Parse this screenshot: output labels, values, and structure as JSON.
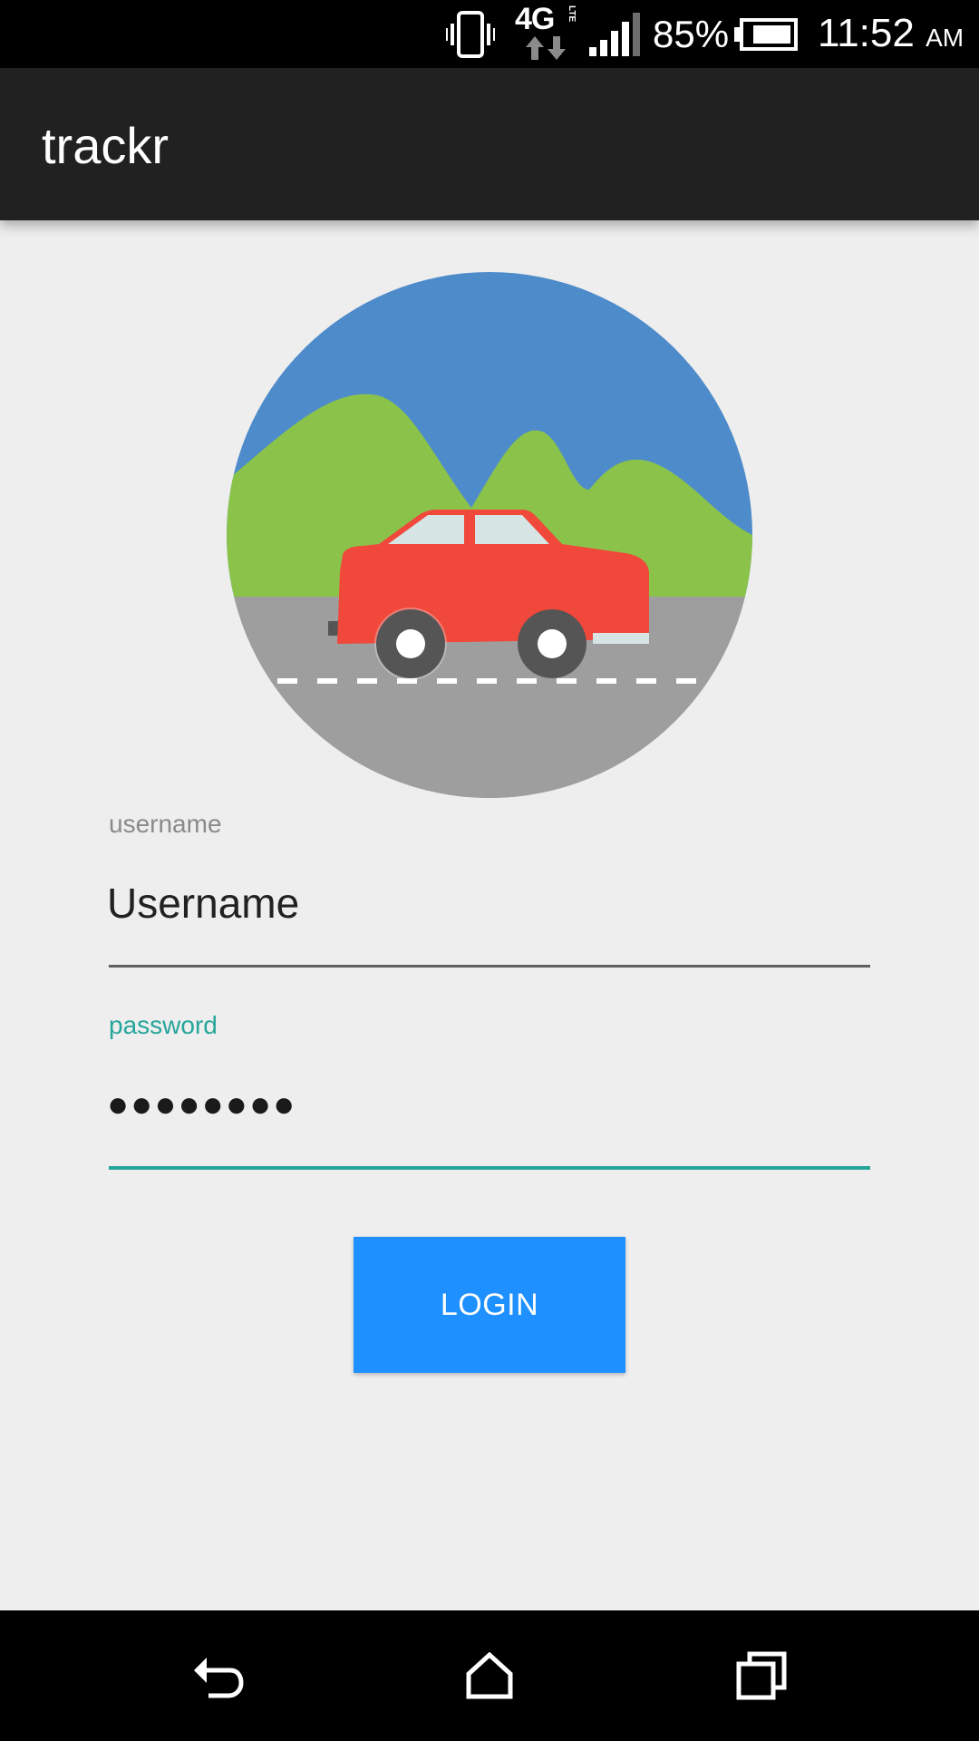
{
  "status_bar": {
    "network_type": "4G",
    "network_subtype": "LTE",
    "battery_percent": "85%",
    "battery_level": 0.85,
    "time": "11:52",
    "am_pm": "AM",
    "icons": [
      "vibrate-icon",
      "data-arrows-icon",
      "signal-icon",
      "battery-icon"
    ]
  },
  "app_bar": {
    "title": "trackr"
  },
  "logo": {
    "icon": "car-landscape-logo",
    "colors": {
      "sky": "#4e8bcb",
      "hills": "#8bc34a",
      "road": "#9e9e9e",
      "car": "#f0483a",
      "windows": "#d6e4e4",
      "wheels": "#555555"
    }
  },
  "form": {
    "username_label": "username",
    "username_value": "Username",
    "password_label": "password",
    "password_value": "●●●●●●●●",
    "login_label": "LOGIN"
  },
  "colors": {
    "accent": "#26a69a",
    "button": "#1e90ff",
    "app_bar": "#212121",
    "background": "#eeeeee"
  },
  "nav_bar": {
    "icons": [
      "back-icon",
      "home-icon",
      "recents-icon"
    ]
  }
}
